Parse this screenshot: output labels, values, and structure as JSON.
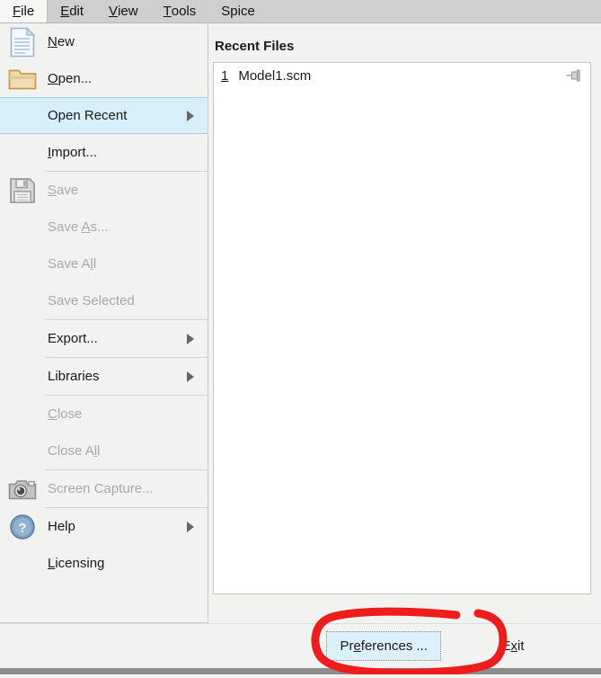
{
  "menubar": {
    "items": [
      {
        "label": "File",
        "mnemonic": "F",
        "active": true
      },
      {
        "label": "Edit",
        "mnemonic": "E",
        "active": false
      },
      {
        "label": "View",
        "mnemonic": "V",
        "active": false
      },
      {
        "label": "Tools",
        "mnemonic": "T",
        "active": false
      },
      {
        "label": "Spice",
        "mnemonic": "",
        "active": false
      }
    ]
  },
  "file_menu": {
    "items": [
      {
        "label": "New",
        "icon": "document-icon",
        "enabled": true,
        "submenu": false,
        "highlight": false
      },
      {
        "label": "Open...",
        "icon": "folder-icon",
        "enabled": true,
        "submenu": false,
        "highlight": false
      },
      {
        "label": "Open Recent",
        "icon": "",
        "enabled": true,
        "submenu": true,
        "highlight": true
      },
      {
        "label": "Import...",
        "icon": "",
        "enabled": true,
        "submenu": false,
        "highlight": false
      },
      {
        "label": "Save",
        "icon": "floppy-disk-icon",
        "enabled": false,
        "submenu": false,
        "highlight": false
      },
      {
        "label": "Save As...",
        "icon": "",
        "enabled": false,
        "submenu": false,
        "highlight": false
      },
      {
        "label": "Save All",
        "icon": "",
        "enabled": false,
        "submenu": false,
        "highlight": false
      },
      {
        "label": "Save Selected",
        "icon": "",
        "enabled": false,
        "submenu": false,
        "highlight": false
      },
      {
        "label": "Export...",
        "icon": "",
        "enabled": true,
        "submenu": true,
        "highlight": false
      },
      {
        "label": "Libraries",
        "icon": "",
        "enabled": true,
        "submenu": true,
        "highlight": false
      },
      {
        "label": "Close",
        "icon": "",
        "enabled": false,
        "submenu": false,
        "highlight": false
      },
      {
        "label": "Close All",
        "icon": "",
        "enabled": false,
        "submenu": false,
        "highlight": false
      },
      {
        "label": "Screen Capture...",
        "icon": "camera-icon",
        "enabled": false,
        "submenu": false,
        "highlight": false
      },
      {
        "label": "Help",
        "icon": "help-circle-icon",
        "enabled": true,
        "submenu": true,
        "highlight": false
      },
      {
        "label": "Licensing",
        "icon": "",
        "enabled": true,
        "submenu": false,
        "highlight": false
      }
    ]
  },
  "recent_files": {
    "title": "Recent Files",
    "rows": [
      {
        "index": "1",
        "name": "Model1.scm",
        "pin_icon": "pushpin-icon"
      }
    ]
  },
  "bottom_bar": {
    "preferences_label": "Preferences ...",
    "exit_label": "Exit"
  },
  "annotation": {
    "shape": "hand-drawn-red-circle",
    "color": "#ee1c1c"
  },
  "colors": {
    "menubar_bg": "#cfcfcf",
    "menu_bg": "#f2f2f0",
    "highlight_bg": "#d8eef9",
    "highlight_border": "#9fcfe8",
    "button_hover_bg": "#dcf0fa",
    "disabled_text": "#a9a9a9",
    "text": "#1a1a1a",
    "annotation_red": "#ee1c1c"
  }
}
